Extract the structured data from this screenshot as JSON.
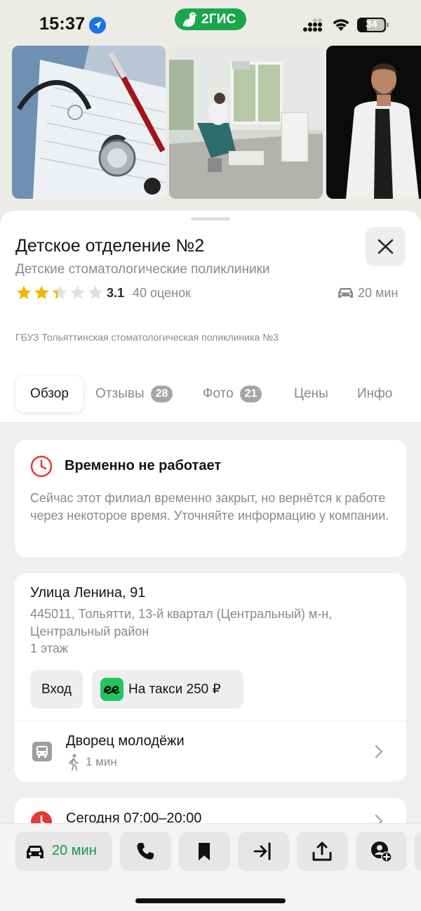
{
  "status_bar": {
    "time": "15:37",
    "battery": "34",
    "brand": "2ГИС"
  },
  "place": {
    "title": "Детское отделение №2",
    "category": "Детские стоматологические поликлиники",
    "rating": {
      "value": "3.1",
      "stars": 3.1,
      "count_label": "40 оценок"
    },
    "eta": "20 мин",
    "organization": "ГБУЗ Тольяттинская стоматологическая поликлиника №3"
  },
  "tabs": [
    {
      "label": "Обзор",
      "active": true
    },
    {
      "label": "Отзывы",
      "badge": "28"
    },
    {
      "label": "Фото",
      "badge": "21"
    },
    {
      "label": "Цены"
    },
    {
      "label": "Инфо"
    }
  ],
  "closed_notice": {
    "title": "Временно не работает",
    "text": "Сейчас этот филиал временно закрыт, но вернётся к работе через некоторое время. Уточняйте информацию у компании."
  },
  "address": {
    "street": "Улица Ленина, 91",
    "detail": "445011, Тольятти, 13-й квартал (Центральный) м-н, Центральный район",
    "floor": "1 этаж",
    "entrance_label": "Вход",
    "taxi_label": "На такси 250 ₽",
    "stop": {
      "name": "Дворец молодёжи",
      "walk_time": "1 мин"
    }
  },
  "hours": {
    "text": "Сегодня 07:00–20:00"
  },
  "bottom_bar": {
    "route_eta": "20 мин"
  },
  "icons": {
    "location": "location-arrow-icon",
    "close": "close-icon",
    "car": "car-icon",
    "clock": "clock-icon",
    "bus": "bus-stop-icon",
    "walk": "walk-icon",
    "chevron": "chevron-right-icon",
    "phone": "phone-icon",
    "bookmark": "bookmark-icon",
    "enter": "enter-icon",
    "share": "share-icon",
    "add_contact": "add-contact-icon"
  },
  "colors": {
    "accent_green": "#1a9a46",
    "brand_green": "#1aa74a",
    "alert_red": "#e53935",
    "star_yellow": "#f5b400"
  }
}
